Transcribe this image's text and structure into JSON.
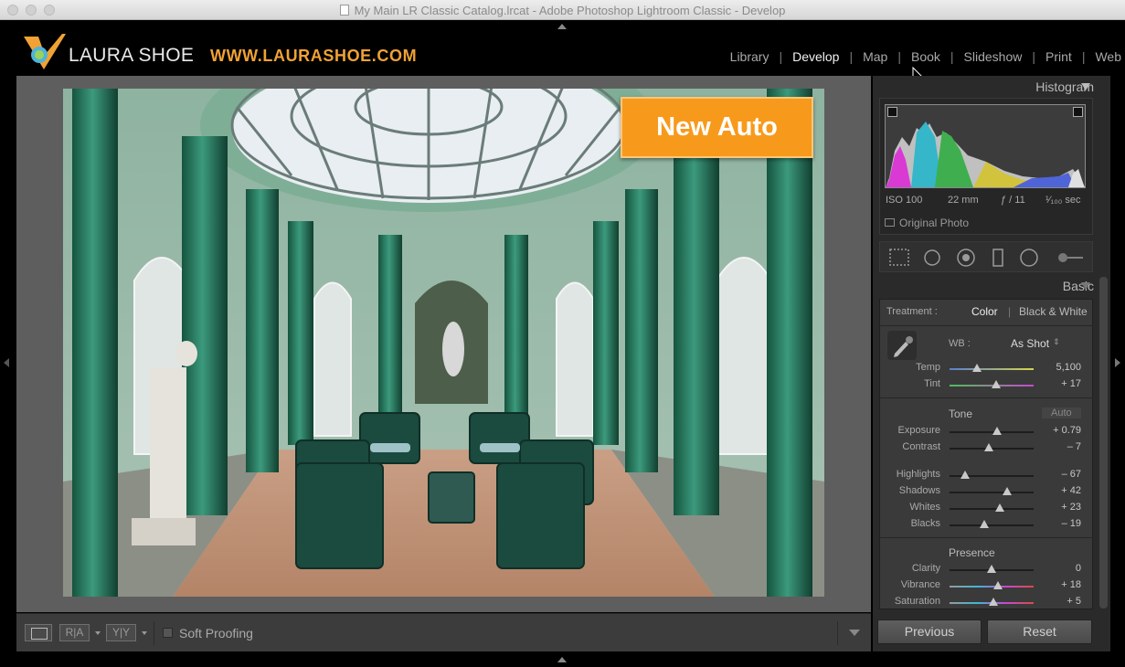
{
  "window": {
    "title": "My Main LR Classic Catalog.lrcat - Adobe Photoshop Lightroom Classic - Develop"
  },
  "identity": {
    "brand": "LAURA SHOE",
    "url": "WWW.LAURASHOE.COM"
  },
  "modules": [
    {
      "label": "Library"
    },
    {
      "label": "Develop"
    },
    {
      "label": "Map"
    },
    {
      "label": "Book"
    },
    {
      "label": "Slideshow"
    },
    {
      "label": "Print"
    },
    {
      "label": "Web"
    }
  ],
  "active_module": "Develop",
  "overlay": {
    "badge": "New Auto"
  },
  "toolbar": {
    "ra_label": "R|A",
    "yy_label": "Y|Y",
    "soft_proofing": "Soft Proofing"
  },
  "histogram": {
    "title": "Histogram",
    "iso": "ISO 100",
    "focal": "22 mm",
    "aperture": "ƒ / 11",
    "shutter": "¹⁄₁₀₀ sec",
    "original_photo": "Original Photo"
  },
  "basic": {
    "title": "Basic",
    "treatment_label": "Treatment :",
    "color": "Color",
    "bw": "Black & White",
    "wb_label": "WB :",
    "wb_value": "As Shot",
    "tone_label": "Tone",
    "auto_label": "Auto",
    "presence_label": "Presence",
    "sliders": {
      "temp": {
        "label": "Temp",
        "value": "5,100",
        "level": 0.33
      },
      "tint": {
        "label": "Tint",
        "value": "+ 17",
        "level": 0.55
      },
      "exposure": {
        "label": "Exposure",
        "value": "+ 0.79",
        "level": 0.57
      },
      "contrast": {
        "label": "Contrast",
        "value": "– 7",
        "level": 0.47
      },
      "highlights": {
        "label": "Highlights",
        "value": "– 67",
        "level": 0.19
      },
      "shadows": {
        "label": "Shadows",
        "value": "+ 42",
        "level": 0.69
      },
      "whites": {
        "label": "Whites",
        "value": "+ 23",
        "level": 0.6
      },
      "blacks": {
        "label": "Blacks",
        "value": "– 19",
        "level": 0.41
      },
      "clarity": {
        "label": "Clarity",
        "value": "0",
        "level": 0.5
      },
      "vibrance": {
        "label": "Vibrance",
        "value": "+ 18",
        "level": 0.58
      },
      "saturation": {
        "label": "Saturation",
        "value": "+ 5",
        "level": 0.52
      }
    }
  },
  "buttons": {
    "previous": "Previous",
    "reset": "Reset"
  },
  "colors": {
    "accent_orange": "#f79a1c",
    "url_orange": "#f0a234",
    "panel": "#3a3a3a"
  }
}
